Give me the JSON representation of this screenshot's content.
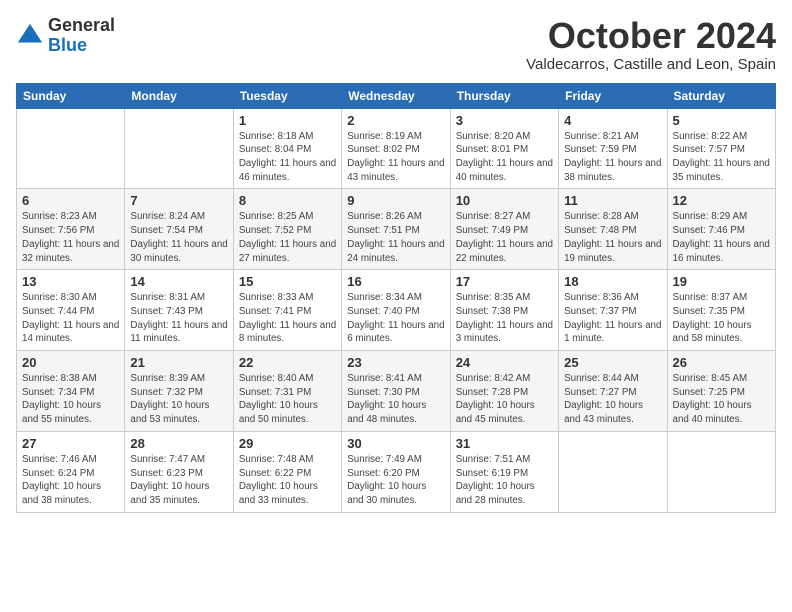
{
  "header": {
    "logo_general": "General",
    "logo_blue": "Blue",
    "month_title": "October 2024",
    "location": "Valdecarros, Castille and Leon, Spain"
  },
  "days_of_week": [
    "Sunday",
    "Monday",
    "Tuesday",
    "Wednesday",
    "Thursday",
    "Friday",
    "Saturday"
  ],
  "weeks": [
    [
      {
        "day": "",
        "info": ""
      },
      {
        "day": "",
        "info": ""
      },
      {
        "day": "1",
        "info": "Sunrise: 8:18 AM\nSunset: 8:04 PM\nDaylight: 11 hours and 46 minutes."
      },
      {
        "day": "2",
        "info": "Sunrise: 8:19 AM\nSunset: 8:02 PM\nDaylight: 11 hours and 43 minutes."
      },
      {
        "day": "3",
        "info": "Sunrise: 8:20 AM\nSunset: 8:01 PM\nDaylight: 11 hours and 40 minutes."
      },
      {
        "day": "4",
        "info": "Sunrise: 8:21 AM\nSunset: 7:59 PM\nDaylight: 11 hours and 38 minutes."
      },
      {
        "day": "5",
        "info": "Sunrise: 8:22 AM\nSunset: 7:57 PM\nDaylight: 11 hours and 35 minutes."
      }
    ],
    [
      {
        "day": "6",
        "info": "Sunrise: 8:23 AM\nSunset: 7:56 PM\nDaylight: 11 hours and 32 minutes."
      },
      {
        "day": "7",
        "info": "Sunrise: 8:24 AM\nSunset: 7:54 PM\nDaylight: 11 hours and 30 minutes."
      },
      {
        "day": "8",
        "info": "Sunrise: 8:25 AM\nSunset: 7:52 PM\nDaylight: 11 hours and 27 minutes."
      },
      {
        "day": "9",
        "info": "Sunrise: 8:26 AM\nSunset: 7:51 PM\nDaylight: 11 hours and 24 minutes."
      },
      {
        "day": "10",
        "info": "Sunrise: 8:27 AM\nSunset: 7:49 PM\nDaylight: 11 hours and 22 minutes."
      },
      {
        "day": "11",
        "info": "Sunrise: 8:28 AM\nSunset: 7:48 PM\nDaylight: 11 hours and 19 minutes."
      },
      {
        "day": "12",
        "info": "Sunrise: 8:29 AM\nSunset: 7:46 PM\nDaylight: 11 hours and 16 minutes."
      }
    ],
    [
      {
        "day": "13",
        "info": "Sunrise: 8:30 AM\nSunset: 7:44 PM\nDaylight: 11 hours and 14 minutes."
      },
      {
        "day": "14",
        "info": "Sunrise: 8:31 AM\nSunset: 7:43 PM\nDaylight: 11 hours and 11 minutes."
      },
      {
        "day": "15",
        "info": "Sunrise: 8:33 AM\nSunset: 7:41 PM\nDaylight: 11 hours and 8 minutes."
      },
      {
        "day": "16",
        "info": "Sunrise: 8:34 AM\nSunset: 7:40 PM\nDaylight: 11 hours and 6 minutes."
      },
      {
        "day": "17",
        "info": "Sunrise: 8:35 AM\nSunset: 7:38 PM\nDaylight: 11 hours and 3 minutes."
      },
      {
        "day": "18",
        "info": "Sunrise: 8:36 AM\nSunset: 7:37 PM\nDaylight: 11 hours and 1 minute."
      },
      {
        "day": "19",
        "info": "Sunrise: 8:37 AM\nSunset: 7:35 PM\nDaylight: 10 hours and 58 minutes."
      }
    ],
    [
      {
        "day": "20",
        "info": "Sunrise: 8:38 AM\nSunset: 7:34 PM\nDaylight: 10 hours and 55 minutes."
      },
      {
        "day": "21",
        "info": "Sunrise: 8:39 AM\nSunset: 7:32 PM\nDaylight: 10 hours and 53 minutes."
      },
      {
        "day": "22",
        "info": "Sunrise: 8:40 AM\nSunset: 7:31 PM\nDaylight: 10 hours and 50 minutes."
      },
      {
        "day": "23",
        "info": "Sunrise: 8:41 AM\nSunset: 7:30 PM\nDaylight: 10 hours and 48 minutes."
      },
      {
        "day": "24",
        "info": "Sunrise: 8:42 AM\nSunset: 7:28 PM\nDaylight: 10 hours and 45 minutes."
      },
      {
        "day": "25",
        "info": "Sunrise: 8:44 AM\nSunset: 7:27 PM\nDaylight: 10 hours and 43 minutes."
      },
      {
        "day": "26",
        "info": "Sunrise: 8:45 AM\nSunset: 7:25 PM\nDaylight: 10 hours and 40 minutes."
      }
    ],
    [
      {
        "day": "27",
        "info": "Sunrise: 7:46 AM\nSunset: 6:24 PM\nDaylight: 10 hours and 38 minutes."
      },
      {
        "day": "28",
        "info": "Sunrise: 7:47 AM\nSunset: 6:23 PM\nDaylight: 10 hours and 35 minutes."
      },
      {
        "day": "29",
        "info": "Sunrise: 7:48 AM\nSunset: 6:22 PM\nDaylight: 10 hours and 33 minutes."
      },
      {
        "day": "30",
        "info": "Sunrise: 7:49 AM\nSunset: 6:20 PM\nDaylight: 10 hours and 30 minutes."
      },
      {
        "day": "31",
        "info": "Sunrise: 7:51 AM\nSunset: 6:19 PM\nDaylight: 10 hours and 28 minutes."
      },
      {
        "day": "",
        "info": ""
      },
      {
        "day": "",
        "info": ""
      }
    ]
  ]
}
